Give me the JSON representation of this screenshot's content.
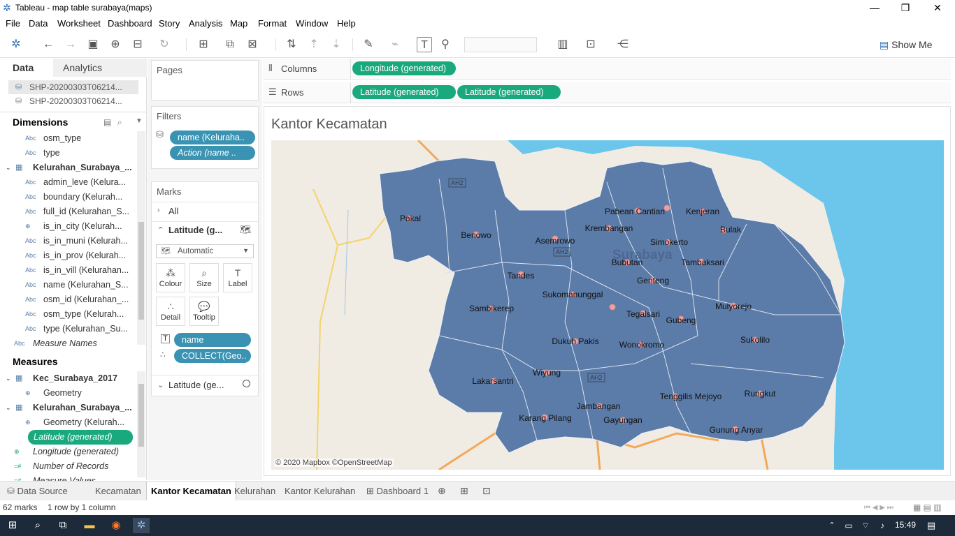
{
  "window": {
    "title": "Tableau - map table surabaya(maps)"
  },
  "menu": [
    "File",
    "Data",
    "Worksheet",
    "Dashboard",
    "Story",
    "Analysis",
    "Map",
    "Format",
    "Window",
    "Help"
  ],
  "toolbar": {
    "show_me_label": "Show Me"
  },
  "left_pane": {
    "tabs": [
      "Data",
      "Analytics"
    ],
    "sources": [
      "SHP-20200303T06214...",
      "SHP-20200303T06214..."
    ],
    "dimensions_header": "Dimensions",
    "dimensions": [
      {
        "icon": "Abc",
        "label": "osm_type"
      },
      {
        "icon": "Abc",
        "label": "type"
      },
      {
        "icon": "table",
        "label": "Kelurahan_Surabaya_..."
      },
      {
        "icon": "Abc",
        "label": "admin_leve (Kelura..."
      },
      {
        "icon": "Abc",
        "label": "boundary (Kelurah..."
      },
      {
        "icon": "Abc",
        "label": "full_id (Kelurahan_S..."
      },
      {
        "icon": "globe",
        "label": "is_in_city (Kelurah..."
      },
      {
        "icon": "Abc",
        "label": "is_in_muni (Kelurah..."
      },
      {
        "icon": "Abc",
        "label": "is_in_prov (Kelurah..."
      },
      {
        "icon": "Abc",
        "label": "is_in_vill (Kelurahan..."
      },
      {
        "icon": "Abc",
        "label": "name (Kelurahan_S..."
      },
      {
        "icon": "Abc",
        "label": "osm_id (Kelurahan_..."
      },
      {
        "icon": "Abc",
        "label": "osm_type (Kelurah..."
      },
      {
        "icon": "Abc",
        "label": "type (Kelurahan_Su..."
      },
      {
        "icon": "Abc",
        "label": "Measure Names"
      }
    ],
    "measures_header": "Measures",
    "measures": [
      {
        "icon": "table",
        "label": "Kec_Surabaya_2017"
      },
      {
        "icon": "globe",
        "label": "Geometry"
      },
      {
        "icon": "table",
        "label": "Kelurahan_Surabaya_..."
      },
      {
        "icon": "globe",
        "label": "Geometry (Kelurah..."
      },
      {
        "icon": "globe",
        "label": "Latitude (generated)"
      },
      {
        "icon": "globe",
        "label": "Longitude (generated)"
      },
      {
        "icon": "#",
        "label": "Number of Records"
      },
      {
        "icon": "#",
        "label": "Measure Values"
      }
    ]
  },
  "cards": {
    "pages": "Pages",
    "filters": "Filters",
    "filter_pills": [
      "name (Keluraha..",
      "Action (name .."
    ],
    "marks": "Marks",
    "marks_all": "All",
    "marks_layer": "Latitude (g...",
    "mark_type": "Automatic",
    "mark_buttons": [
      "Colour",
      "Size",
      "Label",
      "Detail",
      "Tooltip"
    ],
    "mark_pills": [
      "name",
      "COLLECT(Geo.."
    ],
    "marks_layer2": "Latitude (ge..."
  },
  "shelves": {
    "columns_label": "Columns",
    "rows_label": "Rows",
    "columns": [
      "Longitude (generated)"
    ],
    "rows": [
      "Latitude (generated)",
      "Latitude (generated)"
    ]
  },
  "viz": {
    "title": "Kantor Kecamatan",
    "attribution": "© 2020 Mapbox ©OpenStreetMap",
    "road_labels": [
      "AH2",
      "AH2",
      "AH2"
    ],
    "city_label": "Surabaya",
    "districts": [
      "Pakal",
      "Benowo",
      "Asemrowo",
      "Krembangan",
      "Pabean Cantian",
      "Kenjeran",
      "Bulak",
      "Simokerto",
      "Bubutan",
      "Tambaksari",
      "Tandes",
      "Genteng",
      "Sukomanunggal",
      "Sambikerep",
      "Tegalsari",
      "Gubeng",
      "Mulyorejo",
      "Dukuh Pakis",
      "Wonokromo",
      "Sukolilo",
      "Wiyung",
      "Lakarsantri",
      "Tenggilis Mejoyo",
      "Rungkut",
      "Jambangan",
      "Karang Pilang",
      "Gayungan",
      "Gunung Anyar"
    ]
  },
  "bottom_tabs": [
    "Data Source",
    "Kecamatan",
    "Kantor Kecamatan",
    "Kelurahan",
    "Kantor Kelurahan",
    "Dashboard 1"
  ],
  "status": {
    "marks": "62 marks",
    "dims": "1 row by 1 column"
  },
  "taskbar": {
    "time": "15:49"
  },
  "colors": {
    "accent": "#1aa87d",
    "map_fill": "#5b7ba8",
    "water": "#6cc6ec",
    "land": "#f0ece4"
  }
}
